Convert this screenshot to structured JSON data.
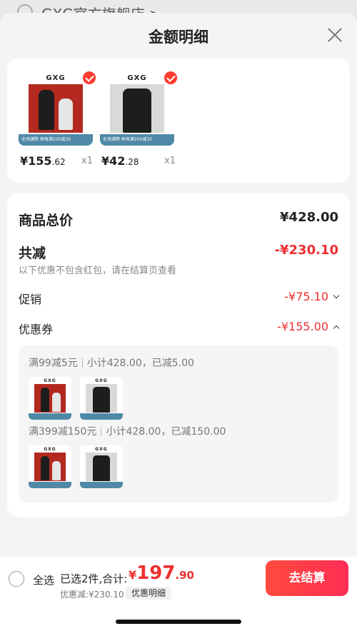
{
  "background": {
    "store_name": "GXG官方旗舰店 >"
  },
  "sheet": {
    "title": "金额明细"
  },
  "products": [
    {
      "brand": "GXG",
      "promo": "全场满降 再每满200减30",
      "price_int": "¥155",
      "price_dec": ".62",
      "qty": "x1"
    },
    {
      "brand": "GXG",
      "promo": "全场满降 再每满200减30",
      "price_int": "¥42",
      "price_dec": ".28",
      "qty": "x1"
    }
  ],
  "summary": {
    "total_label": "商品总价",
    "total_value": "¥428.00",
    "reduce_label": "共减",
    "reduce_value": "-¥230.10",
    "note": "以下优惠不包含红包，请在结算页查看",
    "promo_label": "促销",
    "promo_value": "-¥75.10",
    "coupon_label": "优惠券",
    "coupon_value": "-¥155.00"
  },
  "coupons": [
    {
      "rule": "满99减5元",
      "detail": "小计428.00，已减5.00"
    },
    {
      "rule": "满399减150元",
      "detail": "小计428.00，已减150.00"
    }
  ],
  "bottom": {
    "select_all": "全选",
    "selected": "已选2件,合计:",
    "price_symbol": "¥",
    "price_int": "197",
    "price_dec": ".90",
    "discount": "优惠减:¥230.10",
    "detail_chip": "优惠明细",
    "checkout": "去结算"
  },
  "colors": {
    "accent": "#ee2f2f",
    "promo_band": "#4f89a7"
  }
}
